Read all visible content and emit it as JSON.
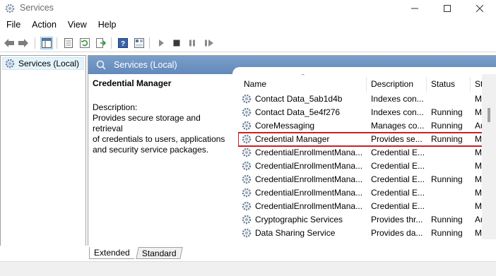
{
  "window": {
    "title": "Services",
    "icon": "gear-icon"
  },
  "menu": [
    "File",
    "Action",
    "View",
    "Help"
  ],
  "tree": {
    "item_label": "Services (Local)"
  },
  "panel": {
    "header": "Services (Local)",
    "selected_name": "Credential Manager",
    "description_label": "Description:",
    "description_lines": [
      "Provides secure storage and retrieval",
      "of credentials to users, applications",
      "and security service packages."
    ]
  },
  "table": {
    "headers": {
      "name": "Name",
      "description": "Description",
      "status": "Status",
      "startup": "St"
    },
    "rows": [
      {
        "name": "Contact Data_5ab1d4b",
        "description": "Indexes con...",
        "status": "",
        "startup": "M"
      },
      {
        "name": "Contact Data_5e4f276",
        "description": "Indexes con...",
        "status": "Running",
        "startup": "M"
      },
      {
        "name": "CoreMessaging",
        "description": "Manages co...",
        "status": "Running",
        "startup": "Au"
      },
      {
        "name": "Credential Manager",
        "description": "Provides se...",
        "status": "Running",
        "startup": "M",
        "highlighted": true
      },
      {
        "name": "CredentialEnrollmentMana...",
        "description": "Credential E...",
        "status": "",
        "startup": "M"
      },
      {
        "name": "CredentialEnrollmentMana...",
        "description": "Credential E...",
        "status": "",
        "startup": "M"
      },
      {
        "name": "CredentialEnrollmentMana...",
        "description": "Credential E...",
        "status": "Running",
        "startup": "M"
      },
      {
        "name": "CredentialEnrollmentMana...",
        "description": "Credential E...",
        "status": "",
        "startup": "M"
      },
      {
        "name": "CredentialEnrollmentMana...",
        "description": "Credential E...",
        "status": "",
        "startup": "M"
      },
      {
        "name": "Cryptographic Services",
        "description": "Provides thr...",
        "status": "Running",
        "startup": "Au"
      },
      {
        "name": "Data Sharing Service",
        "description": "Provides da...",
        "status": "Running",
        "startup": "M"
      }
    ]
  },
  "tabs": {
    "extended": "Extended",
    "standard": "Standard"
  },
  "colors": {
    "header_blue": "#6f93c0",
    "highlight_red": "#cc1f1f",
    "selection_blue": "#e5f3fb"
  }
}
